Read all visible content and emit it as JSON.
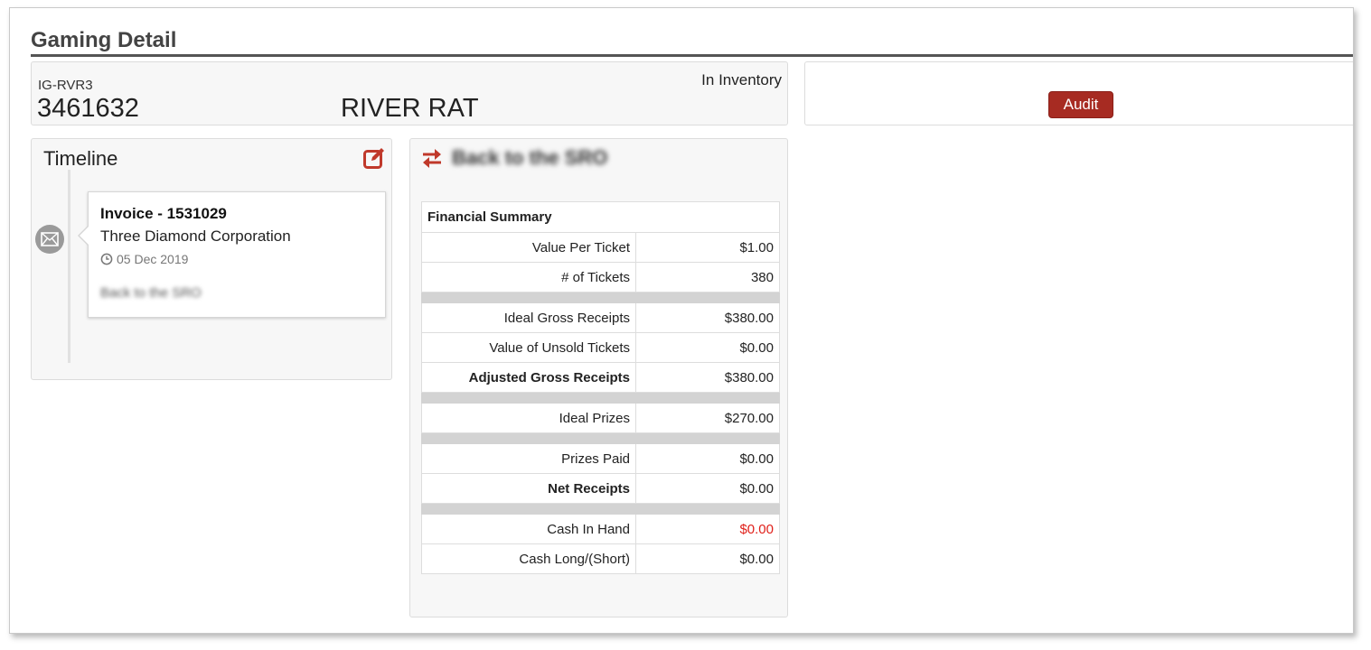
{
  "page": {
    "title": "Gaming Detail"
  },
  "item": {
    "code": "IG-RVR3",
    "number": "3461632",
    "name": "RIVER RAT",
    "status": "In Inventory"
  },
  "actions": {
    "audit_label": "Audit"
  },
  "timeline": {
    "title": "Timeline",
    "entries": [
      {
        "title": "Invoice - 1531029",
        "company": "Three Diamond Corporation",
        "date": "05 Dec 2019",
        "note": "Back to the SRO"
      }
    ]
  },
  "detail": {
    "title": "Back to the SRO"
  },
  "summary": {
    "header": "Financial Summary",
    "value_color_negative": "#e0201a",
    "rows": [
      {
        "label": "Value Per Ticket",
        "value": "$1.00"
      },
      {
        "label": "# of Tickets",
        "value": "380"
      },
      {
        "label": "Ideal Gross Receipts",
        "value": "$380.00"
      },
      {
        "label": "Value of Unsold Tickets",
        "value": "$0.00"
      },
      {
        "label": "Adjusted Gross Receipts",
        "value": "$380.00"
      },
      {
        "label": "Ideal Prizes",
        "value": "$270.00"
      },
      {
        "label": "Prizes Paid",
        "value": "$0.00"
      },
      {
        "label": "Net Receipts",
        "value": "$0.00"
      },
      {
        "label": "Cash In Hand",
        "value": "$0.00"
      },
      {
        "label": "Cash Long/(Short)",
        "value": "$0.00"
      }
    ]
  },
  "colors": {
    "accent": "#a72b22",
    "icon_red": "#c0392b"
  },
  "icons": {
    "edit": "edit-icon",
    "transfer": "transfer-icon",
    "envelope": "envelope-icon",
    "clock": "clock-icon"
  }
}
